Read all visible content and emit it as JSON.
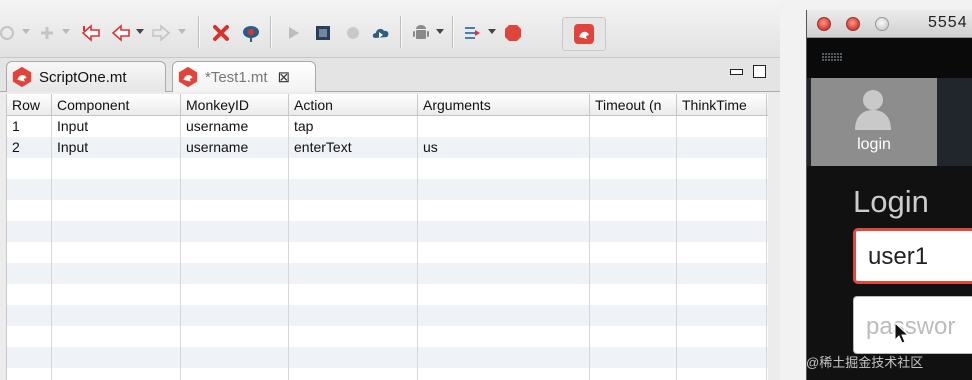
{
  "editor": {
    "tabs": [
      {
        "label": "ScriptOne.mt",
        "active": false
      },
      {
        "label": "*Test1.mt",
        "active": true,
        "close": "⊠"
      }
    ],
    "columns": [
      "Row",
      "Component",
      "MonkeyID",
      "Action",
      "Arguments",
      "Timeout (n",
      "ThinkTime"
    ],
    "rows": [
      [
        "1",
        "Input",
        "username",
        "tap",
        "",
        "",
        ""
      ],
      [
        "2",
        "Input",
        "username",
        "enterText",
        "us",
        "",
        ""
      ]
    ]
  },
  "simulator": {
    "title": "5554",
    "tile_label": "login",
    "heading": "Login",
    "username_value": "user1",
    "password_placeholder": "passwor"
  },
  "watermark": "@稀土掘金技术社区",
  "colors": {
    "accent_red": "#e0443a",
    "stripe": "#eff3f8"
  }
}
